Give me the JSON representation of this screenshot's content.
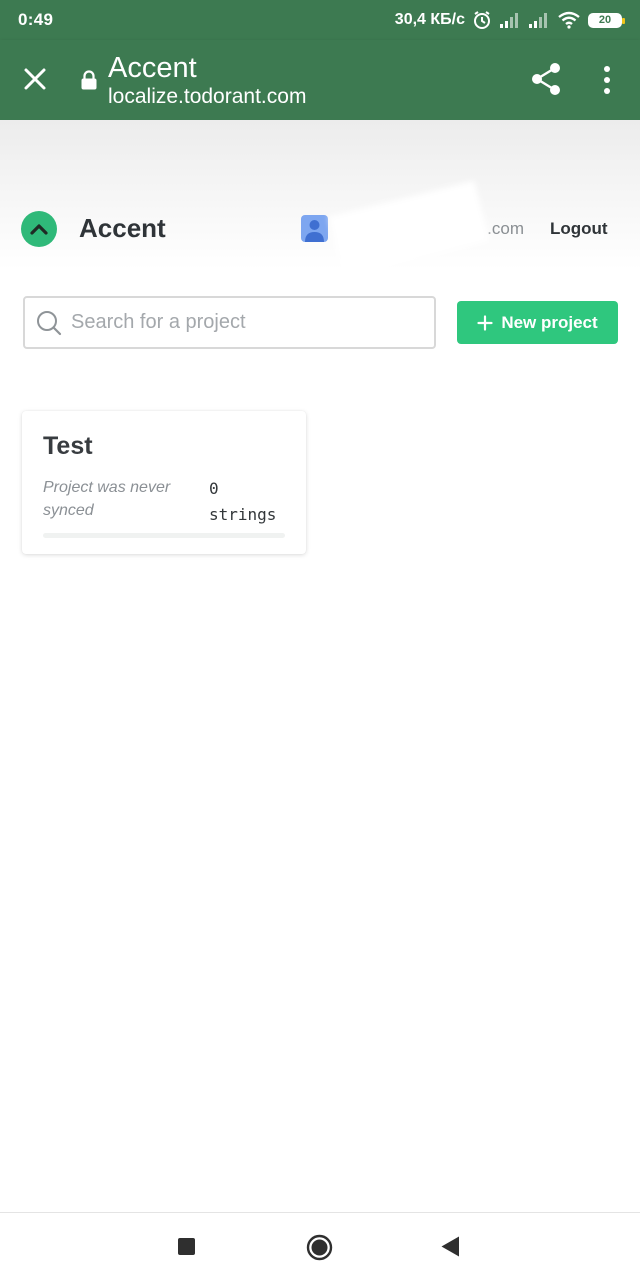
{
  "status_bar": {
    "time": "0:49",
    "network_speed": "30,4 КБ/с",
    "battery": "20",
    "icons": [
      "alarm-icon",
      "signal-icon",
      "signal-icon",
      "wifi-icon",
      "battery-icon"
    ]
  },
  "browser": {
    "title": "Accent",
    "url": "localize.todorant.com",
    "icons": [
      "close-icon",
      "lock-icon",
      "share-icon",
      "more-vert-icon"
    ]
  },
  "header": {
    "brand": "Accent",
    "user_email_visible": ".com",
    "logout_label": "Logout",
    "colors": {
      "brand_green": "#2fb979",
      "toolbar_green": "#3d7a51"
    }
  },
  "search": {
    "placeholder": "Search for a project",
    "value": ""
  },
  "new_project": {
    "label": "New project",
    "color": "#2fc77e"
  },
  "projects": [
    {
      "name": "Test",
      "sync_status": "Project was never synced",
      "string_count": "0",
      "string_unit": "strings",
      "progress": 0
    }
  ],
  "nav_bar": {
    "buttons": [
      "recents-button",
      "home-button",
      "back-button"
    ]
  }
}
